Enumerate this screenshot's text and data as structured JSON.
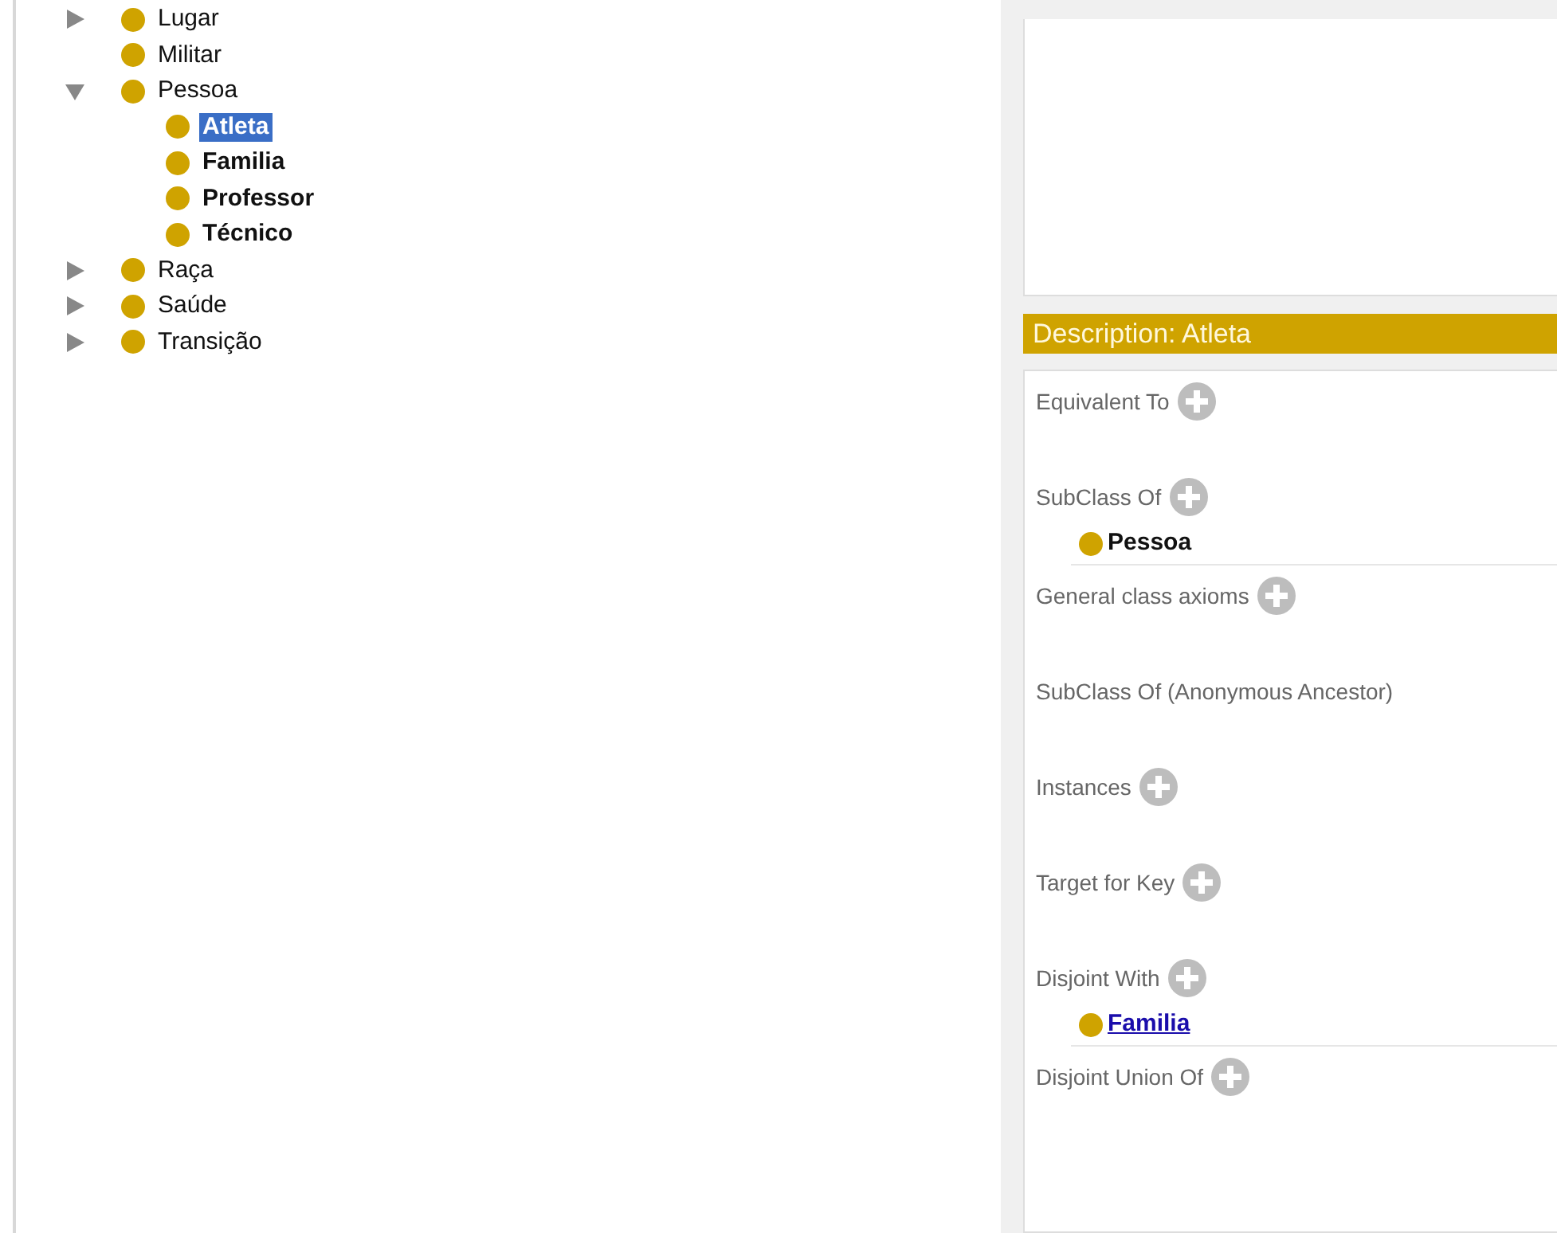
{
  "class_tree": [
    {
      "label": "Lugar",
      "expanded": false,
      "bold": false,
      "selected": false
    },
    {
      "label": "Militar",
      "bold": false,
      "selected": false
    },
    {
      "label": "Pessoa",
      "expanded": true,
      "bold": false,
      "selected": false,
      "children": [
        {
          "label": "Atleta",
          "bold": true,
          "selected": true
        },
        {
          "label": "Familia",
          "bold": true,
          "selected": false
        },
        {
          "label": "Professor",
          "bold": true,
          "selected": false
        },
        {
          "label": "Técnico",
          "bold": true,
          "selected": false
        }
      ]
    },
    {
      "label": "Raça",
      "expanded": false,
      "bold": false,
      "selected": false
    },
    {
      "label": "Saúde",
      "expanded": false,
      "bold": false,
      "selected": false
    },
    {
      "label": "Transição",
      "expanded": false,
      "bold": false,
      "selected": false
    }
  ],
  "description": {
    "title": "Description: Atleta",
    "sections": [
      {
        "label": "Equivalent To",
        "has_add": true
      },
      {
        "label": "SubClass Of",
        "has_add": true,
        "items": [
          {
            "label": "Pessoa",
            "kind": "plain"
          }
        ]
      },
      {
        "label": "General class axioms",
        "has_add": true
      },
      {
        "label": "SubClass Of (Anonymous Ancestor)",
        "has_add": false
      },
      {
        "label": "Instances",
        "has_add": true
      },
      {
        "label": "Target for Key",
        "has_add": true
      },
      {
        "label": "Disjoint With",
        "has_add": true,
        "items": [
          {
            "label": "Familia",
            "kind": "link"
          }
        ]
      },
      {
        "label": "Disjoint Union Of",
        "has_add": true
      }
    ]
  }
}
